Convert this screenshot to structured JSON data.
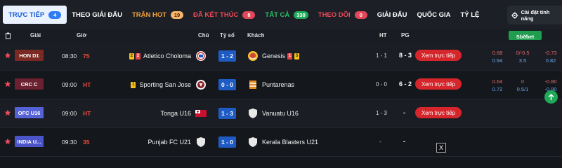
{
  "tabs": [
    {
      "label": "TRỰC TIẾP",
      "badge": "4"
    },
    {
      "label": "THEO GIẢI ĐẤU"
    },
    {
      "label": "TRẬN HOT",
      "badge": "19"
    },
    {
      "label": "ĐÃ KẾT THÚC",
      "badge": "8"
    },
    {
      "label": "TẤT CẢ",
      "badge": "338"
    },
    {
      "label": "THEO DÕI",
      "badge": "0"
    },
    {
      "label": "GIẢI ĐẤU"
    },
    {
      "label": "QUỐC GIA"
    },
    {
      "label": "TỶ LỆ"
    }
  ],
  "settings_label": "Cài đặt tính năng",
  "header": {
    "league": "Giải",
    "time": "Giờ",
    "home": "Chủ",
    "score": "Tỷ số",
    "away": "Khách",
    "ht": "HT",
    "pg": "PG",
    "bookmaker": "Sbobet"
  },
  "live_button_label": "Xem trực tiếp",
  "close_label": "X",
  "colors": {
    "row_bg_odd": "#1a1d23",
    "row_bg_even": "#14171c",
    "league_hon": "#7a2a22",
    "league_crc": "#6b2130",
    "league_ofc": "#5562d6",
    "league_india": "#4b55c9",
    "score_bg": "#1f5bc4",
    "live_button": "#d6262c"
  },
  "matches": [
    {
      "league": "HON D1",
      "time": "08:30",
      "status": "75",
      "home": "Atletico Choloma",
      "home_cards": [
        "2",
        "2"
      ],
      "score": "1 - 2",
      "away": "Genesis",
      "away_cards": [
        "1",
        "5"
      ],
      "ht": "1 - 1",
      "pg": "8 - 3",
      "has_live": true,
      "odds": {
        "c1": [
          "0.68",
          "0.94"
        ],
        "c2": [
          "0/-0.5",
          "3.5"
        ],
        "c3": [
          "-0.73",
          "0.82"
        ]
      }
    },
    {
      "league": "CRC C",
      "time": "09:00",
      "status": "HT",
      "home": "Sporting San Jose",
      "home_cards": [
        "1"
      ],
      "score": "0 - 0",
      "away": "Puntarenas",
      "away_cards": [],
      "ht": "0 - 0",
      "pg": "6 - 2",
      "has_live": true,
      "odds": {
        "c1": [
          "0.64",
          "0.72"
        ],
        "c2": [
          "0",
          "0.5/1"
        ],
        "c3": [
          "-0.80",
          "-0.90"
        ]
      }
    },
    {
      "league": "OFC U16",
      "time": "09:00",
      "status": "HT",
      "home": "Tonga U16",
      "home_cards": [],
      "score": "1 - 3",
      "away": "Vanuatu U16",
      "away_cards": [],
      "ht": "1 - 3",
      "pg": "-",
      "has_live": true
    },
    {
      "league": "INDIA U...",
      "time": "09:30",
      "status": "35",
      "home": "Punjab FC U21",
      "home_cards": [],
      "score": "1 - 0",
      "away": "Kerala Blasters U21",
      "away_cards": [],
      "ht": "-",
      "pg": "-",
      "has_live": false
    }
  ]
}
